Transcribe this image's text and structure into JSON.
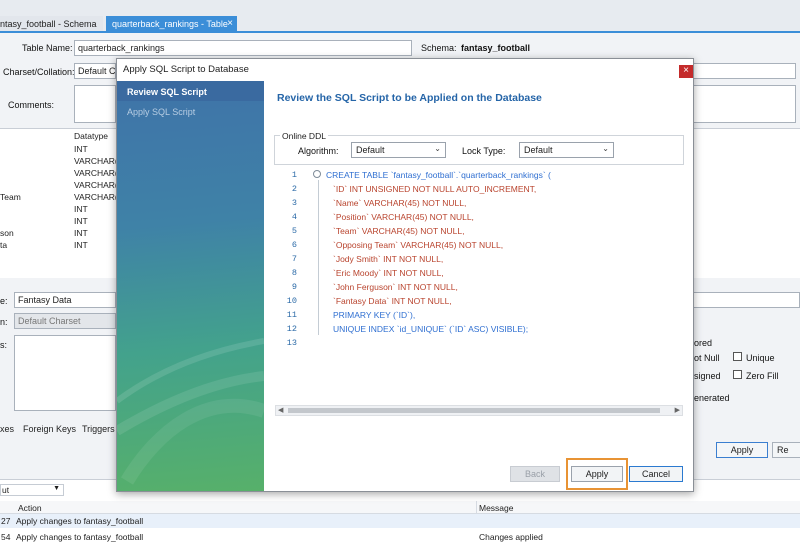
{
  "tabs": [
    {
      "label": "ntasy_football - Schema"
    },
    {
      "label": "quarterback_rankings - Table",
      "close": "×"
    }
  ],
  "form": {
    "table_name_label": "Table Name:",
    "table_name_value": "quarterback_rankings",
    "schema_label": "Schema:",
    "schema_value": "fantasy_football",
    "charset_label": "Charset/Collation:",
    "charset_value": "Default Ch",
    "comments_label": "Comments:"
  },
  "grid": {
    "header": "Datatype",
    "rows": [
      {
        "name": "",
        "type": "INT"
      },
      {
        "name": "",
        "type": "VARCHAR(4"
      },
      {
        "name": "",
        "type": "VARCHAR(4"
      },
      {
        "name": "",
        "type": "VARCHAR(4"
      },
      {
        "name": "Team",
        "type": "VARCHAR(4"
      },
      {
        "name": "",
        "type": "INT"
      },
      {
        "name": "",
        "type": "INT"
      },
      {
        "name": "son",
        "type": "INT"
      },
      {
        "name": "ta",
        "type": "INT"
      }
    ]
  },
  "column_details": {
    "name_label": "e:",
    "name_value": "Fantasy Data",
    "charset_label": "n:",
    "charset_value": "Default Charset",
    "comments_label": "s:",
    "storage_label": "ored",
    "not_null_label": "ot Null",
    "unique_label": "Unique",
    "unsigned_label": "signed",
    "zero_fill_label": "Zero Fill",
    "generated_label": "enerated"
  },
  "bottom_tabs": [
    "xes",
    "Foreign Keys",
    "Triggers"
  ],
  "right_buttons": {
    "apply": "Apply",
    "revert": "Re"
  },
  "output": {
    "selector": "ut",
    "columns": {
      "action": "Action",
      "message": "Message"
    },
    "rows": [
      {
        "num": "27",
        "action": "Apply changes to fantasy_football",
        "message": ""
      },
      {
        "num": "54",
        "action": "Apply changes to fantasy_football",
        "message": "Changes applied"
      }
    ]
  },
  "dialog": {
    "title": "Apply SQL Script to Database",
    "close": "×",
    "steps": [
      "Review SQL Script",
      "Apply SQL Script"
    ],
    "heading": "Review the SQL Script to be Applied on the Database",
    "online_ddl": {
      "legend": "Online DDL",
      "algorithm_label": "Algorithm:",
      "algorithm_value": "Default",
      "lock_label": "Lock Type:",
      "lock_value": "Default"
    },
    "sql_lines": [
      "CREATE TABLE `fantasy_football`.`quarterback_rankings` (",
      "`ID` INT UNSIGNED NOT NULL AUTO_INCREMENT,",
      "`Name` VARCHAR(45) NOT NULL,",
      "`Position` VARCHAR(45) NOT NULL,",
      "`Team` VARCHAR(45) NOT NULL,",
      "`Opposing Team` VARCHAR(45) NOT NULL,",
      "`Jody Smith` INT NOT NULL,",
      "`Eric Moody` INT NOT NULL,",
      "`John Ferguson` INT NOT NULL,",
      "`Fantasy Data` INT NOT NULL,",
      "PRIMARY KEY (`ID`),",
      "UNIQUE INDEX `id_UNIQUE` (`ID` ASC) VISIBLE);",
      ""
    ],
    "line_numbers": [
      "1",
      "2",
      "3",
      "4",
      "5",
      "6",
      "7",
      "8",
      "9",
      "10",
      "11",
      "12",
      "13"
    ],
    "buttons": {
      "back": "Back",
      "apply": "Apply",
      "cancel": "Cancel"
    }
  },
  "colors": {
    "accent": "#3b8ed8",
    "highlight": "#e89334",
    "heading": "#2565a8"
  }
}
